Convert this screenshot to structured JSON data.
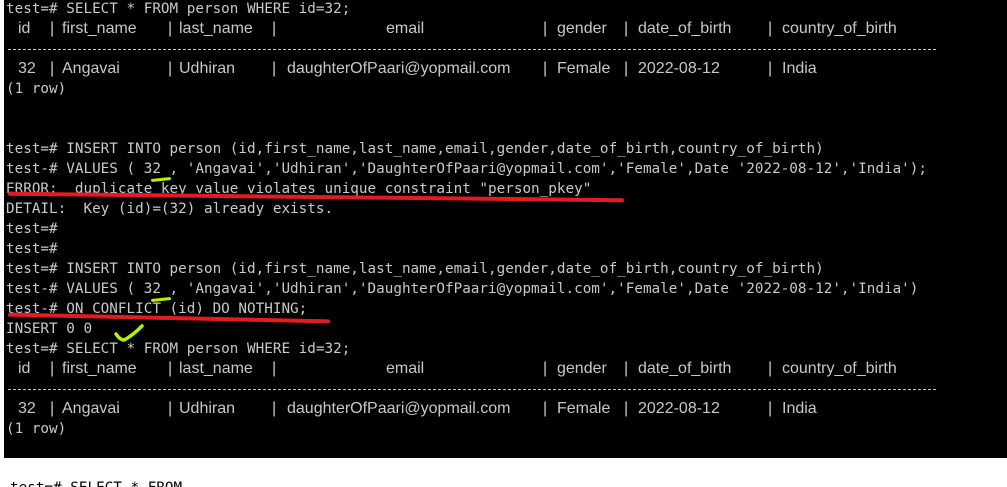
{
  "terminal": {
    "line_1": "test=# SELECT * FROM person WHERE id=32;",
    "table_1": {
      "headers": [
        "id",
        "first_name",
        "last_name",
        "email",
        "gender",
        "date_of_birth",
        "country_of_birth"
      ],
      "row": [
        "32",
        "Angavai",
        "Udhiran",
        "daughterOfPaari@yopmail.com",
        "Female",
        "2022-08-12",
        "India"
      ],
      "row_count": "(1 row)"
    },
    "insert_1_a": "test=# INSERT INTO person (id,first_name,last_name,email,gender,date_of_birth,country_of_birth)",
    "insert_1_b": "test-# VALUES ( 32 , 'Angavai','Udhiran','DaughterOfPaari@yopmail.com','Female',Date '2022-08-12','India');",
    "error_line": "ERROR:  duplicate key value violates unique constraint \"person_pkey\"",
    "detail_line": "DETAIL:  Key (id)=(32) already exists.",
    "prompt_blank_1": "test=#",
    "prompt_blank_2": "test=#",
    "insert_2_a": "test=# INSERT INTO person (id,first_name,last_name,email,gender,date_of_birth,country_of_birth)",
    "insert_2_b": "test-# VALUES ( 32 , 'Angavai','Udhiran','DaughterOfPaari@yopmail.com','Female',Date '2022-08-12','India')",
    "insert_2_c": "test-# ON CONFLICT (id) DO NOTHING;",
    "insert_result": "INSERT 0 0",
    "line_select_2": "test=# SELECT * FROM person WHERE id=32;",
    "table_2": {
      "headers": [
        "id",
        "first_name",
        "last_name",
        "email",
        "gender",
        "date_of_birth",
        "country_of_birth"
      ],
      "row": [
        "32",
        "Angavai",
        "Udhiran",
        "daughterOfPaari@yopmail.com",
        "Female",
        "2022-08-12",
        "India"
      ],
      "row_count": "(1 row)"
    },
    "cut_line": "test=# SELECT * FROM"
  },
  "colors": {
    "background": "#000000",
    "text": "#c8c8c8",
    "annotation_red": "#e31c24",
    "annotation_green": "#b4f000"
  }
}
